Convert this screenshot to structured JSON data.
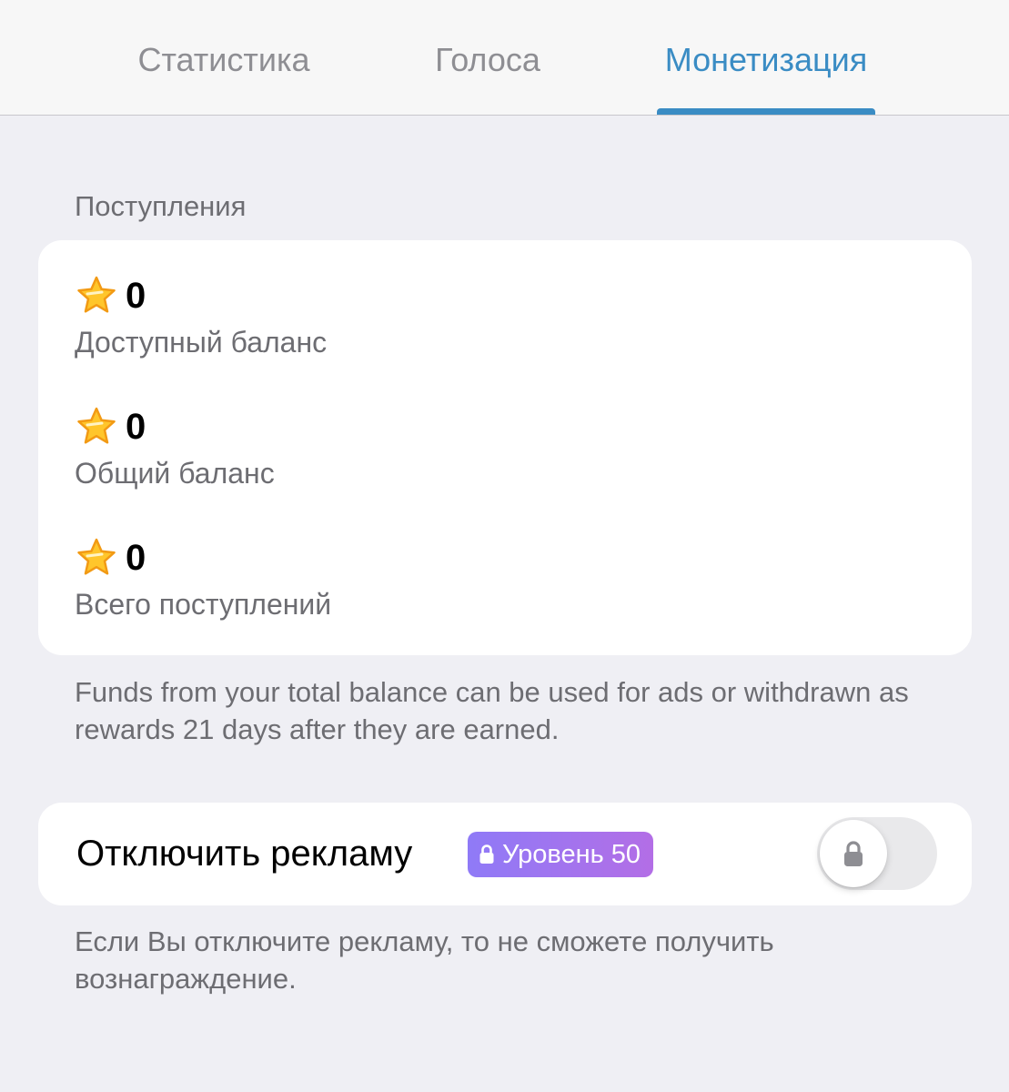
{
  "colors": {
    "background": "#efeff4",
    "accent": "#3a8cc4",
    "secondary_text": "#6d6d72",
    "badge_gradient_start": "#8f7af7",
    "badge_gradient_end": "#b36ee6"
  },
  "tabs": [
    {
      "label": "Статистика",
      "active": false
    },
    {
      "label": "Голоса",
      "active": false
    },
    {
      "label": "Монетизация",
      "active": true
    }
  ],
  "proceeds": {
    "header": "Поступления",
    "rows": [
      {
        "icon": "star-icon",
        "value": "0",
        "label": "Доступный баланс"
      },
      {
        "icon": "star-icon",
        "value": "0",
        "label": "Общий баланс"
      },
      {
        "icon": "star-icon",
        "value": "0",
        "label": "Всего поступлений"
      }
    ],
    "footnote": "Funds from your total balance can be used for ads or withdrawn as rewards 21 days after they are earned."
  },
  "ads": {
    "title": "Отключить рекламу",
    "badge": {
      "icon": "lock-icon",
      "label": "Уровень 50"
    },
    "toggle": {
      "on": false,
      "locked": true,
      "icon": "lock-icon"
    },
    "footnote": "Если Вы отключите рекламу, то не сможете получить вознаграждение."
  }
}
